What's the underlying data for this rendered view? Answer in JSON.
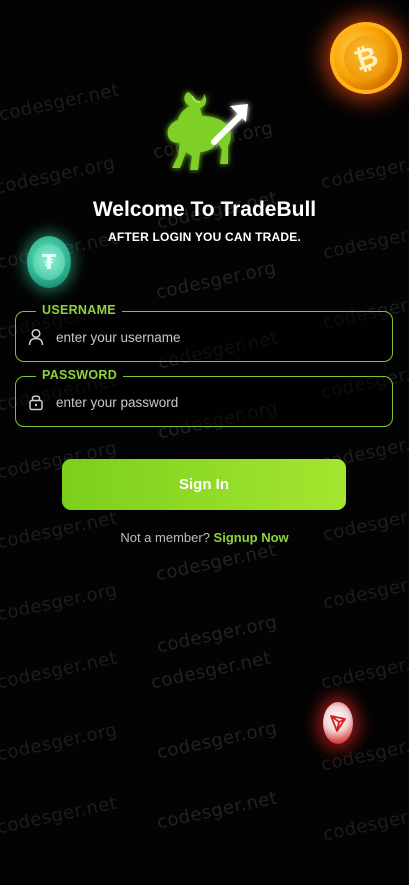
{
  "header": {
    "title": "Welcome To TradeBull",
    "subtitle": "AFTER LOGIN YOU CAN TRADE."
  },
  "form": {
    "username": {
      "label": "USERNAME",
      "placeholder": "enter your username",
      "value": "",
      "icon": "user-icon"
    },
    "password": {
      "label": "PASSWORD",
      "placeholder": "enter your password",
      "value": "",
      "icon": "lock-icon"
    },
    "submit_label": "Sign In"
  },
  "signup": {
    "prompt": "Not a member?",
    "link_label": "Signup Now"
  },
  "watermark": "codesger.net",
  "watermark_alt": "codesger.org",
  "colors": {
    "accent": "#8fd43a",
    "button_start": "#7ccf1c",
    "button_end": "#a4e630",
    "background": "#030303"
  }
}
